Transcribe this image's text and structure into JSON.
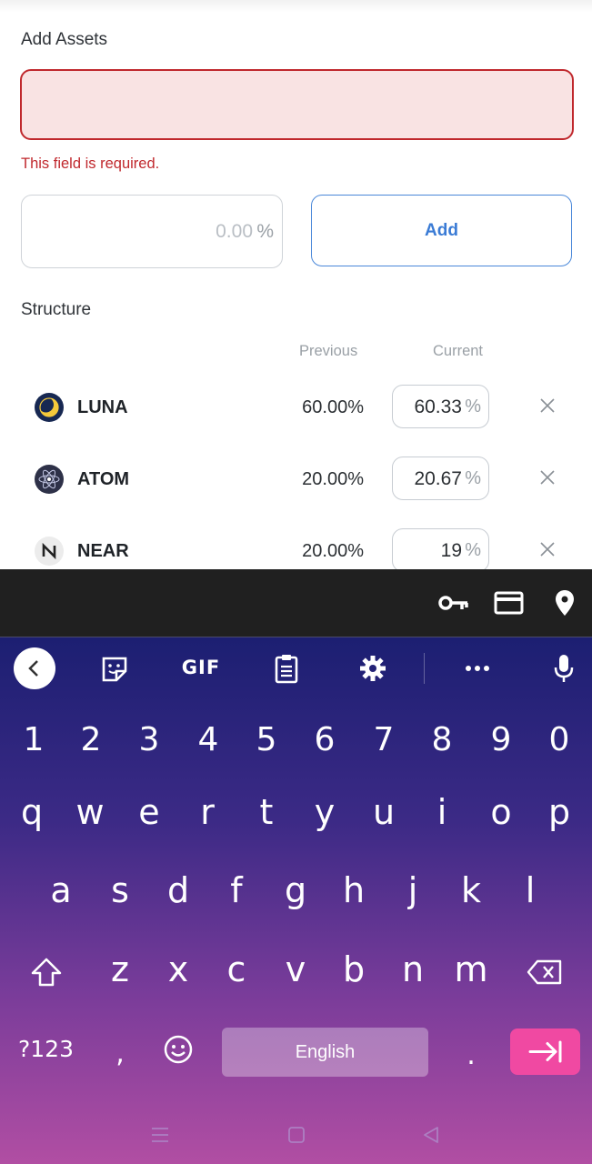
{
  "form": {
    "add_assets_label": "Add Assets",
    "asset_input_value": "",
    "error_message": "This field is required.",
    "percent_placeholder": "0.00",
    "percent_symbol": "%",
    "add_button_label": "Add"
  },
  "structure": {
    "title": "Structure",
    "columns": {
      "previous": "Previous",
      "current": "Current"
    },
    "rows": [
      {
        "name": "LUNA",
        "previous": "60.00%",
        "current": "60.33",
        "unit": "%"
      },
      {
        "name": "ATOM",
        "previous": "20.00%",
        "current": "20.67",
        "unit": "%"
      },
      {
        "name": "NEAR",
        "previous": "20.00%",
        "current": "19",
        "unit": "%"
      }
    ]
  },
  "keyboard": {
    "toolbar_icons": [
      "key-icon",
      "credit-card-icon",
      "location-pin-icon"
    ],
    "top_row": [
      "back-arrow-icon",
      "sticker-icon",
      "GIF",
      "clipboard-icon",
      "settings-icon",
      "more-icon",
      "microphone-icon"
    ],
    "gif_label": "GIF",
    "numbers": [
      "1",
      "2",
      "3",
      "4",
      "5",
      "6",
      "7",
      "8",
      "9",
      "0"
    ],
    "row1": [
      "q",
      "w",
      "e",
      "r",
      "t",
      "y",
      "u",
      "i",
      "o",
      "p"
    ],
    "row2": [
      "a",
      "s",
      "d",
      "f",
      "g",
      "h",
      "j",
      "k",
      "l"
    ],
    "row3": [
      "z",
      "x",
      "c",
      "v",
      "b",
      "n",
      "m"
    ],
    "symbols_label": "?123",
    "comma": ",",
    "period": ".",
    "space_label": "English"
  },
  "colors": {
    "error": "#c0282d",
    "error_bg": "#f9e3e3",
    "accent": "#3a7bd5",
    "enter_key": "#f049a2"
  }
}
